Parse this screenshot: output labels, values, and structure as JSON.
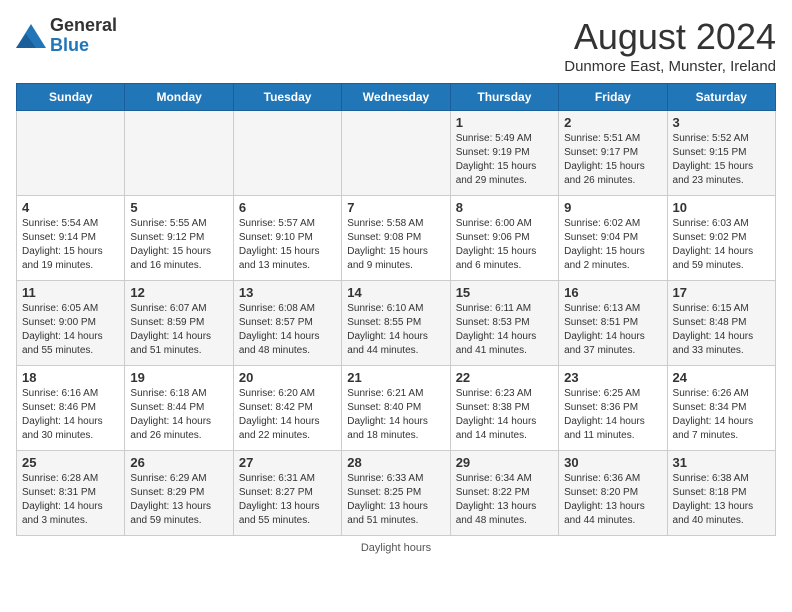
{
  "header": {
    "logo_general": "General",
    "logo_blue": "Blue",
    "main_title": "August 2024",
    "subtitle": "Dunmore East, Munster, Ireland"
  },
  "days_of_week": [
    "Sunday",
    "Monday",
    "Tuesday",
    "Wednesday",
    "Thursday",
    "Friday",
    "Saturday"
  ],
  "weeks": [
    [
      {
        "day": "",
        "info": ""
      },
      {
        "day": "",
        "info": ""
      },
      {
        "day": "",
        "info": ""
      },
      {
        "day": "",
        "info": ""
      },
      {
        "day": "1",
        "info": "Sunrise: 5:49 AM\nSunset: 9:19 PM\nDaylight: 15 hours\nand 29 minutes."
      },
      {
        "day": "2",
        "info": "Sunrise: 5:51 AM\nSunset: 9:17 PM\nDaylight: 15 hours\nand 26 minutes."
      },
      {
        "day": "3",
        "info": "Sunrise: 5:52 AM\nSunset: 9:15 PM\nDaylight: 15 hours\nand 23 minutes."
      }
    ],
    [
      {
        "day": "4",
        "info": "Sunrise: 5:54 AM\nSunset: 9:14 PM\nDaylight: 15 hours\nand 19 minutes."
      },
      {
        "day": "5",
        "info": "Sunrise: 5:55 AM\nSunset: 9:12 PM\nDaylight: 15 hours\nand 16 minutes."
      },
      {
        "day": "6",
        "info": "Sunrise: 5:57 AM\nSunset: 9:10 PM\nDaylight: 15 hours\nand 13 minutes."
      },
      {
        "day": "7",
        "info": "Sunrise: 5:58 AM\nSunset: 9:08 PM\nDaylight: 15 hours\nand 9 minutes."
      },
      {
        "day": "8",
        "info": "Sunrise: 6:00 AM\nSunset: 9:06 PM\nDaylight: 15 hours\nand 6 minutes."
      },
      {
        "day": "9",
        "info": "Sunrise: 6:02 AM\nSunset: 9:04 PM\nDaylight: 15 hours\nand 2 minutes."
      },
      {
        "day": "10",
        "info": "Sunrise: 6:03 AM\nSunset: 9:02 PM\nDaylight: 14 hours\nand 59 minutes."
      }
    ],
    [
      {
        "day": "11",
        "info": "Sunrise: 6:05 AM\nSunset: 9:00 PM\nDaylight: 14 hours\nand 55 minutes."
      },
      {
        "day": "12",
        "info": "Sunrise: 6:07 AM\nSunset: 8:59 PM\nDaylight: 14 hours\nand 51 minutes."
      },
      {
        "day": "13",
        "info": "Sunrise: 6:08 AM\nSunset: 8:57 PM\nDaylight: 14 hours\nand 48 minutes."
      },
      {
        "day": "14",
        "info": "Sunrise: 6:10 AM\nSunset: 8:55 PM\nDaylight: 14 hours\nand 44 minutes."
      },
      {
        "day": "15",
        "info": "Sunrise: 6:11 AM\nSunset: 8:53 PM\nDaylight: 14 hours\nand 41 minutes."
      },
      {
        "day": "16",
        "info": "Sunrise: 6:13 AM\nSunset: 8:51 PM\nDaylight: 14 hours\nand 37 minutes."
      },
      {
        "day": "17",
        "info": "Sunrise: 6:15 AM\nSunset: 8:48 PM\nDaylight: 14 hours\nand 33 minutes."
      }
    ],
    [
      {
        "day": "18",
        "info": "Sunrise: 6:16 AM\nSunset: 8:46 PM\nDaylight: 14 hours\nand 30 minutes."
      },
      {
        "day": "19",
        "info": "Sunrise: 6:18 AM\nSunset: 8:44 PM\nDaylight: 14 hours\nand 26 minutes."
      },
      {
        "day": "20",
        "info": "Sunrise: 6:20 AM\nSunset: 8:42 PM\nDaylight: 14 hours\nand 22 minutes."
      },
      {
        "day": "21",
        "info": "Sunrise: 6:21 AM\nSunset: 8:40 PM\nDaylight: 14 hours\nand 18 minutes."
      },
      {
        "day": "22",
        "info": "Sunrise: 6:23 AM\nSunset: 8:38 PM\nDaylight: 14 hours\nand 14 minutes."
      },
      {
        "day": "23",
        "info": "Sunrise: 6:25 AM\nSunset: 8:36 PM\nDaylight: 14 hours\nand 11 minutes."
      },
      {
        "day": "24",
        "info": "Sunrise: 6:26 AM\nSunset: 8:34 PM\nDaylight: 14 hours\nand 7 minutes."
      }
    ],
    [
      {
        "day": "25",
        "info": "Sunrise: 6:28 AM\nSunset: 8:31 PM\nDaylight: 14 hours\nand 3 minutes."
      },
      {
        "day": "26",
        "info": "Sunrise: 6:29 AM\nSunset: 8:29 PM\nDaylight: 13 hours\nand 59 minutes."
      },
      {
        "day": "27",
        "info": "Sunrise: 6:31 AM\nSunset: 8:27 PM\nDaylight: 13 hours\nand 55 minutes."
      },
      {
        "day": "28",
        "info": "Sunrise: 6:33 AM\nSunset: 8:25 PM\nDaylight: 13 hours\nand 51 minutes."
      },
      {
        "day": "29",
        "info": "Sunrise: 6:34 AM\nSunset: 8:22 PM\nDaylight: 13 hours\nand 48 minutes."
      },
      {
        "day": "30",
        "info": "Sunrise: 6:36 AM\nSunset: 8:20 PM\nDaylight: 13 hours\nand 44 minutes."
      },
      {
        "day": "31",
        "info": "Sunrise: 6:38 AM\nSunset: 8:18 PM\nDaylight: 13 hours\nand 40 minutes."
      }
    ]
  ],
  "footer": {
    "daylight_label": "Daylight hours"
  }
}
